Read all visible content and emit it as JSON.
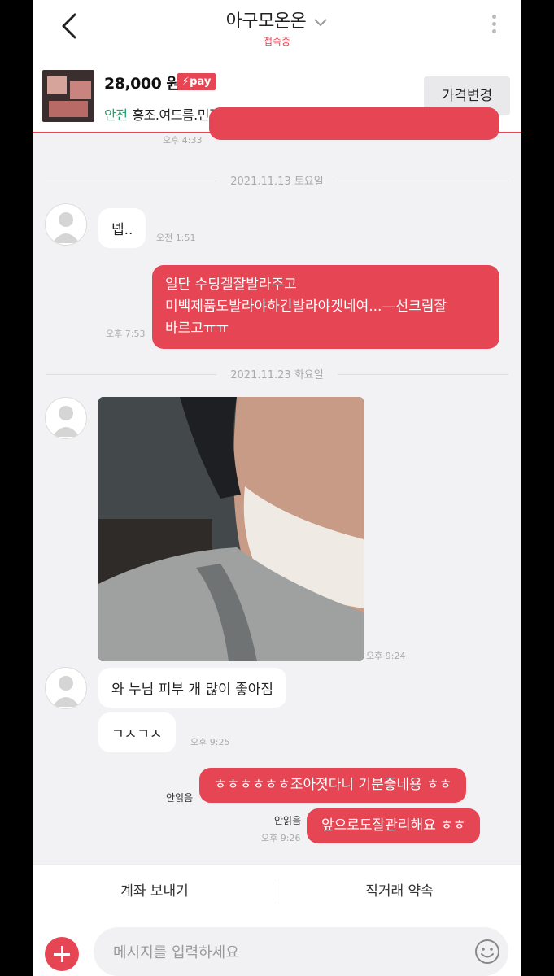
{
  "header": {
    "title": "아구모온온",
    "status": "접속중"
  },
  "product": {
    "price": "28,000 원",
    "pay_badge": "pay",
    "safe_label": "안전",
    "description": "홍조.여드름.민감한피부,아토피,지루성,수부...",
    "price_change_button": "가격변경"
  },
  "messages": {
    "top_time": "오후 4:33",
    "date1": "2021.11.13 토요일",
    "msg1": "넵..",
    "msg1_time": "오전 1:51",
    "msg2_lines": [
      "일단 수딩겔잘발라주고",
      "미백제품도발라야하긴발라야겟네여...—선크림잘",
      "바르고ㅠㅠ"
    ],
    "msg2_time": "오후 7:53",
    "date2": "2021.11.23 화요일",
    "photo_time": "오후 9:24",
    "msg3": "와 누님 피부 개 많이 좋아짐",
    "msg4": "ㄱㅅㄱㅅ",
    "msg4_time": "오후 9:25",
    "msg5_unread": "안읽음",
    "msg5": "ㅎㅎㅎㅎㅎㅎ조아졋다니 기분좋네용 ㅎㅎ",
    "msg6_unread": "안읽음",
    "msg6_time": "오후 9:26",
    "msg6": "앞으로도잘관리해요 ㅎㅎ"
  },
  "actions": {
    "send_account": "계좌 보내기",
    "direct_deal": "직거래 약속"
  },
  "input": {
    "placeholder": "메시지를 입력하세요"
  },
  "colors": {
    "accent": "#e64553",
    "safe": "#22a06b"
  },
  "icons": [
    "back-arrow-icon",
    "chevron-down-icon",
    "more-vertical-icon",
    "lightning-icon",
    "user-avatar-icon",
    "plus-icon",
    "emoji-icon"
  ]
}
